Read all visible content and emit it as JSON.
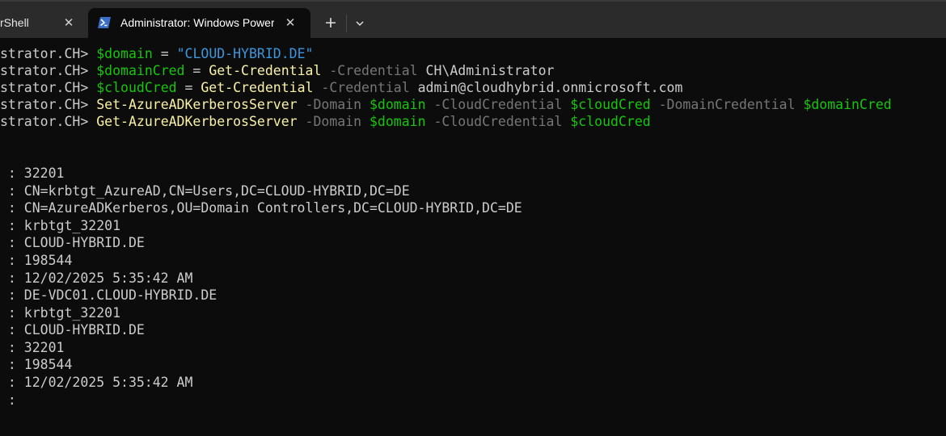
{
  "tabs": [
    {
      "label": "rShell",
      "close_icon": "close-icon"
    },
    {
      "label": "Administrator: Windows PowerShell",
      "close_icon": "close-icon",
      "active": true
    }
  ],
  "toolbar": {
    "new_tab": "+",
    "dropdown_icon": "chevron-down-icon"
  },
  "colors": {
    "background": "#0c0c0c",
    "tabbar": "#2b2b2b",
    "variable": "#16c60c",
    "string": "#3a96dd",
    "cmdlet": "#f9f1a5",
    "parameter": "#767676",
    "text": "#cccccc"
  },
  "terminal": {
    "commands": [
      {
        "prompt": "strator.CH> ",
        "var": "$domain",
        "op": " = ",
        "str": "\"CLOUD-HYBRID.DE\""
      },
      {
        "prompt": "strator.CH> ",
        "var": "$domainCred",
        "op": " = ",
        "cmd": "Get-Credential",
        "p1": " -Credential",
        "a1": " CH\\Administrator"
      },
      {
        "prompt": "strator.CH> ",
        "var": "$cloudCred",
        "op": " = ",
        "cmd": "Get-Credential",
        "p1": " -Credential",
        "a1": " admin@cloudhybrid.onmicrosoft.com"
      },
      {
        "prompt": "strator.CH> ",
        "cmd": "Set-AzureADKerberosServer",
        "p1": " -Domain ",
        "v1": "$domain",
        "p2": " -CloudCredential ",
        "v2": "$cloudCred",
        "p3": " -DomainCredential ",
        "v3": "$domainCred"
      },
      {
        "prompt": "strator.CH> ",
        "cmd": "Get-AzureADKerberosServer",
        "p1": " -Domain ",
        "v1": "$domain",
        "p2": " -CloudCredential ",
        "v2": "$cloudCred"
      }
    ],
    "output": [
      " : 32201",
      " : CN=krbtgt_AzureAD,CN=Users,DC=CLOUD-HYBRID,DC=DE",
      " : CN=AzureADKerberos,OU=Domain Controllers,DC=CLOUD-HYBRID,DC=DE",
      " : krbtgt_32201",
      " : CLOUD-HYBRID.DE",
      " : 198544",
      " : 12/02/2025 5:35:42 AM",
      " : DE-VDC01.CLOUD-HYBRID.DE",
      " : krbtgt_32201",
      " : CLOUD-HYBRID.DE",
      " : 32201",
      " : 198544",
      " : 12/02/2025 5:35:42 AM",
      " :"
    ]
  }
}
